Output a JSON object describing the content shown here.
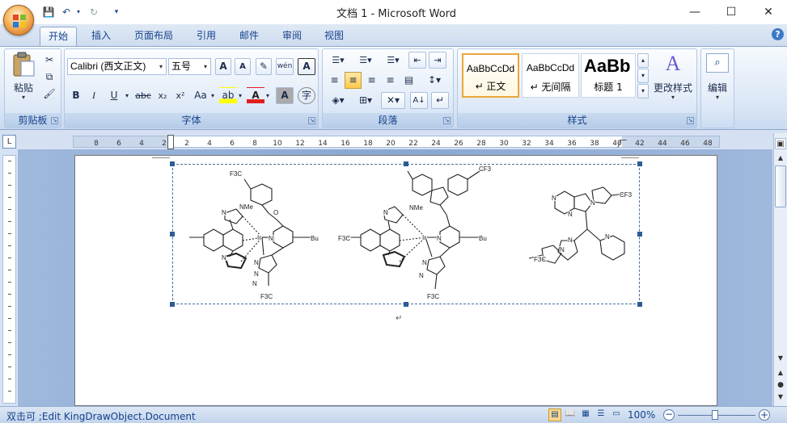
{
  "window": {
    "title": "文档 1 - Microsoft Word",
    "minimize": "—",
    "maximize": "☐",
    "close": "✕"
  },
  "qat": {
    "save": "💾",
    "undo": "↶",
    "redo": "↻",
    "more": "▾"
  },
  "tabs": [
    "开始",
    "插入",
    "页面布局",
    "引用",
    "邮件",
    "审阅",
    "视图"
  ],
  "help": "?",
  "clipboard": {
    "paste": "粘贴",
    "label": "剪贴板"
  },
  "font": {
    "name": "Calibri (西文正文)",
    "size": "五号",
    "grow": "A",
    "shrink": "A",
    "label": "字体",
    "bold": "B",
    "italic": "I",
    "underline": "U",
    "strike": "abc",
    "sub": "x₂",
    "sup": "x²",
    "case": "Aa"
  },
  "paragraph": {
    "label": "段落"
  },
  "styles": {
    "label": "样式",
    "items": [
      {
        "sample": "AaBbCcDd",
        "name": "↵ 正文"
      },
      {
        "sample": "AaBbCcDd",
        "name": "↵ 无间隔"
      },
      {
        "sample": "AaBb",
        "name": "标题 1"
      }
    ],
    "change": "更改样式"
  },
  "editing": {
    "label": "编辑"
  },
  "ruler": {
    "ticks": [
      "8",
      "6",
      "4",
      "2",
      "2",
      "4",
      "6",
      "8",
      "10",
      "12",
      "14",
      "16",
      "18",
      "20",
      "22",
      "24",
      "26",
      "28",
      "30",
      "32",
      "34",
      "36",
      "38",
      "40",
      "42",
      "44",
      "46",
      "48"
    ]
  },
  "status": {
    "text": "双击可 ;Edit KingDrawObject.Document",
    "zoom": "100%"
  },
  "chem": {
    "labels": [
      "F3C",
      "NMe",
      "O",
      "Ir",
      "N",
      "N",
      "N",
      "Bu",
      "N",
      "N",
      "F3C",
      "N",
      "CF3",
      "NMe",
      "Ir",
      "N",
      "N",
      "Bu",
      "F3C",
      "N",
      "N",
      "F3C",
      "N",
      "N",
      "CF3",
      "N",
      "N",
      "N",
      "F3C",
      "N"
    ],
    "t": [
      "t",
      "t"
    ]
  },
  "colors": {
    "accent": "#15428b",
    "selection": "#2c5c96"
  }
}
